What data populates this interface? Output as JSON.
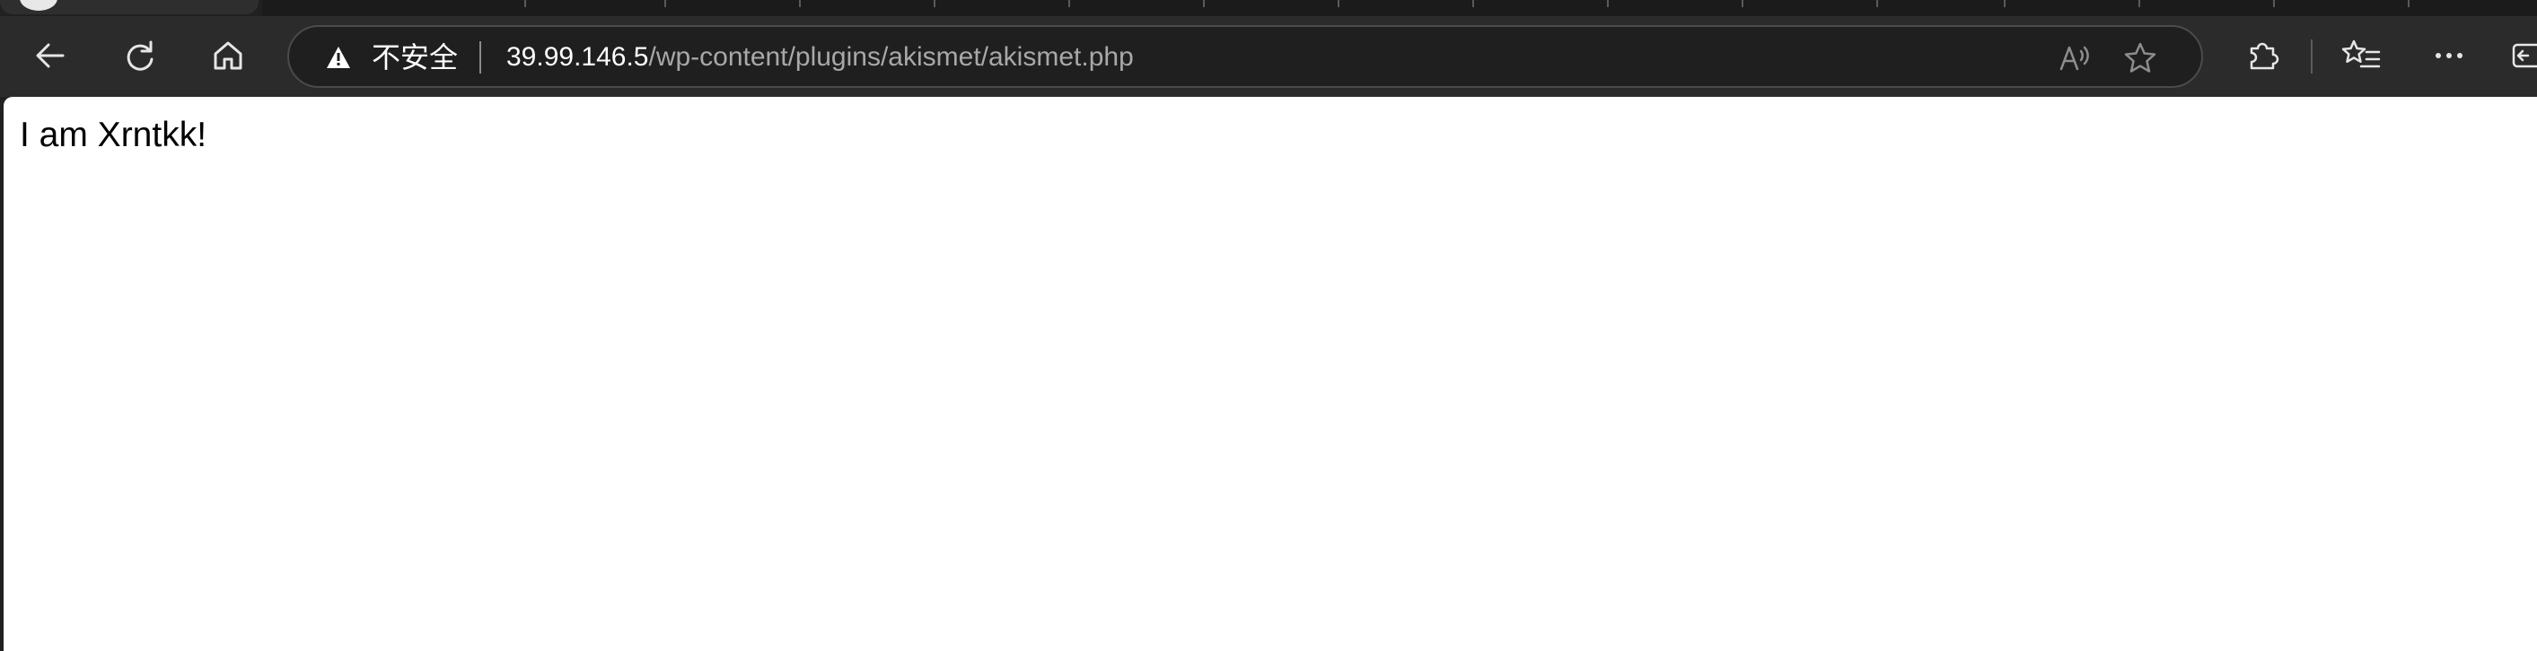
{
  "browser": {
    "address_bar": {
      "security_label": "不安全",
      "url_host": "39.99.146.5",
      "url_path": "/wp-content/plugins/akismet/akismet.php"
    },
    "icons": {
      "back": "back-arrow-icon",
      "refresh": "refresh-icon",
      "home": "home-icon",
      "warning": "warning-triangle-icon",
      "read_aloud": "read-aloud-icon",
      "favorite": "star-icon",
      "extensions": "puzzle-icon",
      "favorites": "favorites-list-icon",
      "more": "more-icon",
      "sidebar": "sidebar-icon"
    }
  },
  "page": {
    "body_text": "I am Xrntkk!"
  }
}
